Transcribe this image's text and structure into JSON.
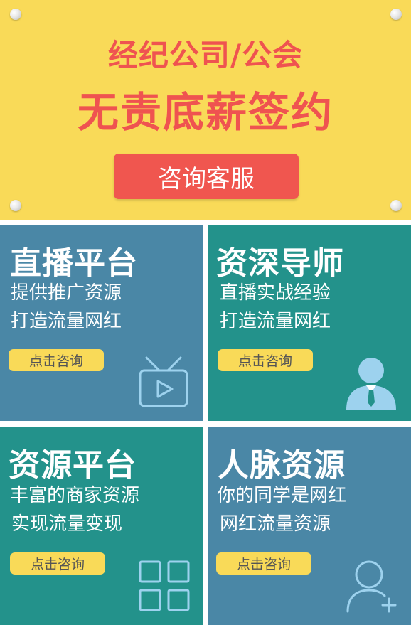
{
  "banner": {
    "title_line1": "经纪公司/公会",
    "title_line2": "无责底薪签约",
    "cta_label": "咨询客服"
  },
  "tiles": [
    {
      "title": "直播平台",
      "line1": "提供推广资源",
      "line2": "打造流量网红",
      "button": "点击咨询",
      "icon": "tv-icon"
    },
    {
      "title": "资深导师",
      "line1": "直播实战经验",
      "line2": "打造流量网红",
      "button": "点击咨询",
      "icon": "mentor-avatar-icon"
    },
    {
      "title": "资源平台",
      "line1": "丰富的商家资源",
      "line2": "实现流量变现",
      "button": "点击咨询",
      "icon": "grid-icon"
    },
    {
      "title": "人脉资源",
      "line1": "你的同学是网红",
      "line2": "网红流量资源",
      "button": "点击咨询",
      "icon": "add-user-icon"
    }
  ],
  "colors": {
    "banner_bg": "#f9da58",
    "title_red": "#ef5350",
    "cta_bg": "#f0564f",
    "tile_blue": "#4a87a6",
    "tile_teal": "#23928b",
    "button_yellow": "#f9da58",
    "icon_light_blue": "#9dd2ee"
  }
}
